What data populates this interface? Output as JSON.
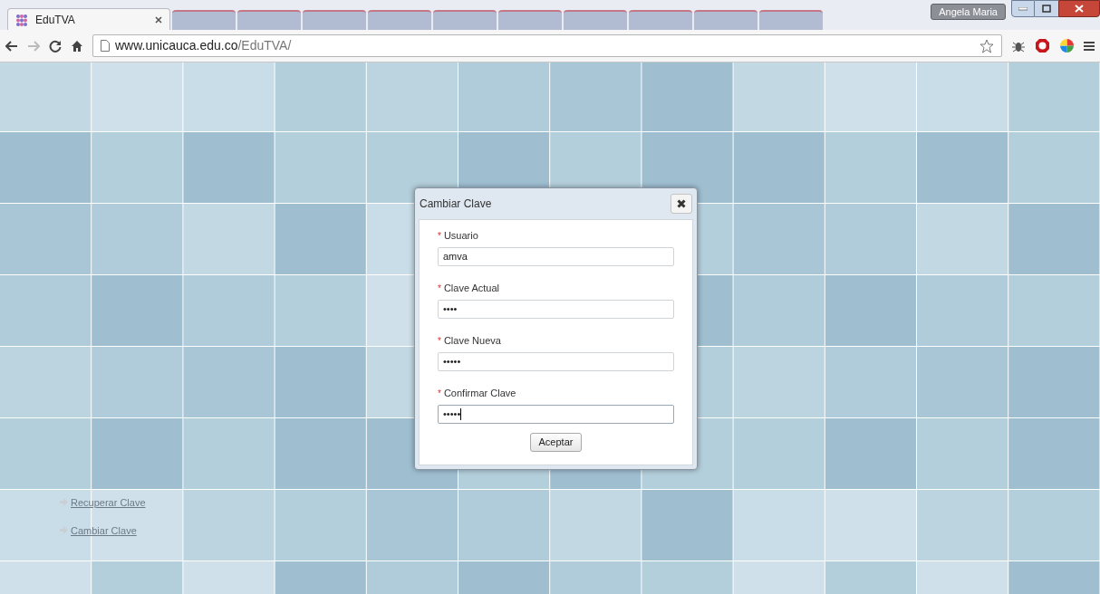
{
  "browser": {
    "tabs": [
      {
        "title": "EduTVA",
        "selected": true
      },
      {
        "selected": false
      },
      {
        "selected": false
      },
      {
        "selected": false
      },
      {
        "selected": false
      },
      {
        "selected": false
      },
      {
        "selected": false
      },
      {
        "selected": false
      },
      {
        "selected": false
      },
      {
        "selected": false
      },
      {
        "selected": false
      }
    ],
    "profile": "Angela Maria",
    "url_host": "www.unicauca.edu.co",
    "url_path": "/EduTVA/"
  },
  "dialog": {
    "title": "Cambiar Clave",
    "fields": [
      {
        "required_mark": "*",
        "label": "Usuario",
        "value": "amva",
        "focused": false
      },
      {
        "required_mark": "*",
        "label": "Clave Actual",
        "value": "••••",
        "focused": false
      },
      {
        "required_mark": "*",
        "label": "Clave Nueva",
        "value": "•••••",
        "focused": false
      },
      {
        "required_mark": "*",
        "label": "Confirmar Clave",
        "value": "•••••",
        "focused": true
      }
    ],
    "submit": "Aceptar"
  },
  "links": [
    "Recuperar Clave",
    "Cambiar Clave"
  ]
}
